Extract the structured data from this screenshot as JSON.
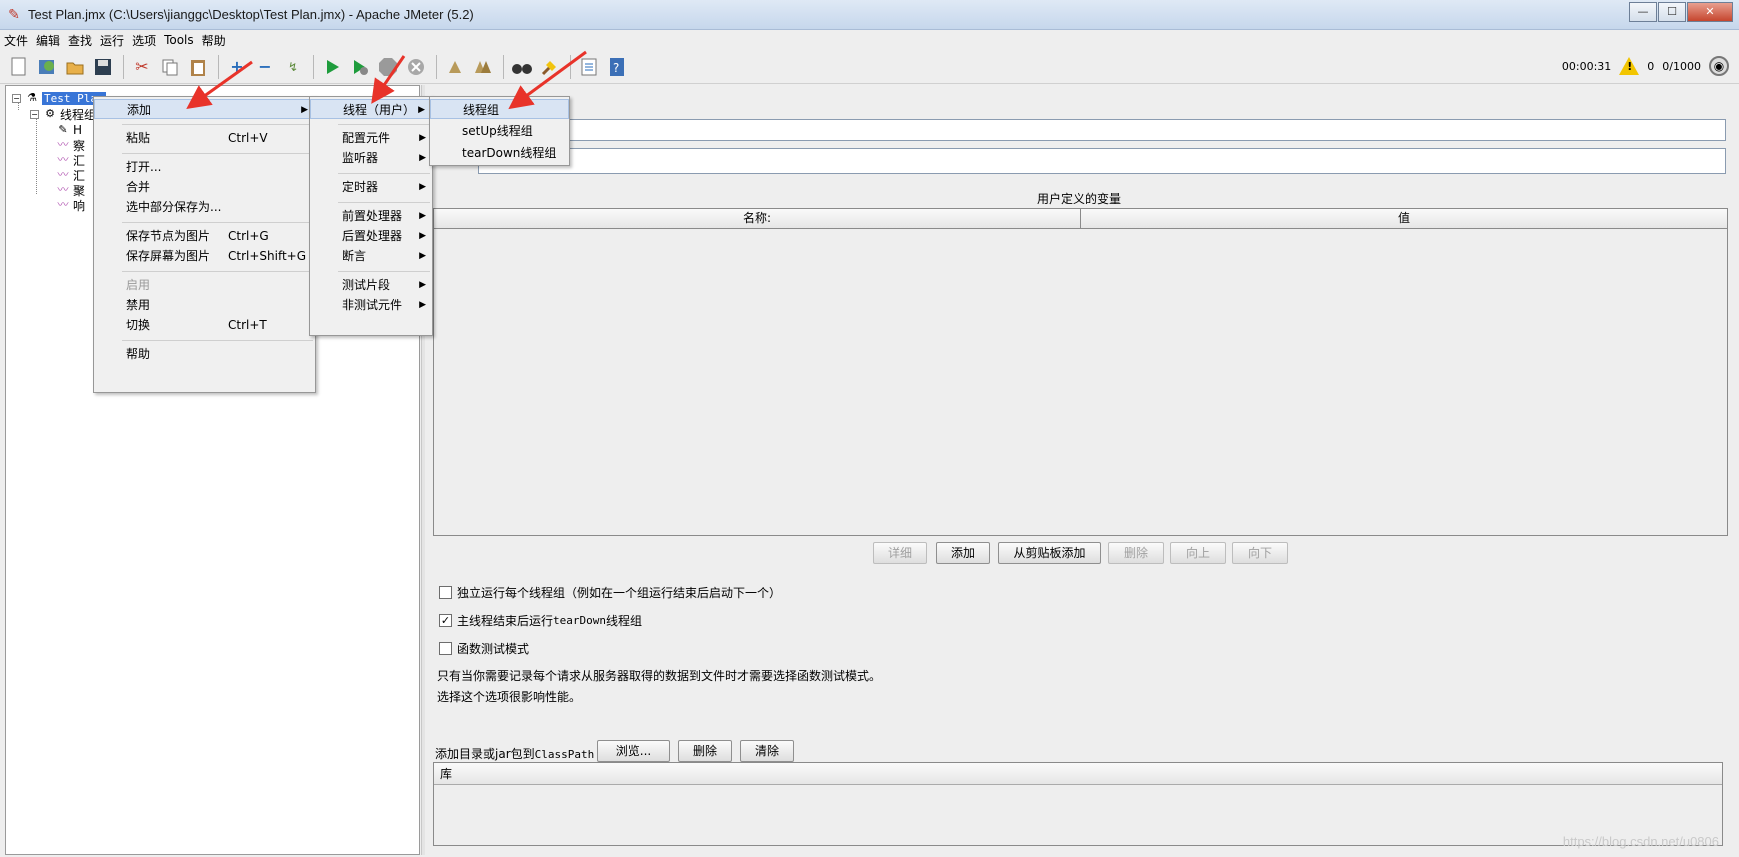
{
  "window": {
    "title": "Test Plan.jmx (C:\\Users\\jianggc\\Desktop\\Test Plan.jmx) - Apache JMeter (5.2)"
  },
  "menubar": [
    "文件",
    "编辑",
    "查找",
    "运行",
    "选项",
    "Tools",
    "帮助"
  ],
  "toolbar": {
    "icons": [
      "new-icon",
      "templates-icon",
      "open-icon",
      "save-icon",
      "cut-icon",
      "copy-icon",
      "paste-icon",
      "expand-icon",
      "collapse-icon",
      "toggle-icon",
      "start-icon",
      "start-no-pause-icon",
      "stop-icon",
      "shutdown-icon",
      "clear-icon",
      "clear-all-icon",
      "search-icon",
      "reset-search-icon",
      "function-helper-icon",
      "help-icon"
    ],
    "timer": "00:00:31",
    "warnings": "0",
    "threads": "0/1000"
  },
  "tree": {
    "root": "Test Plan",
    "thread_group": "线程组",
    "children": [
      "H",
      "察",
      "汇",
      "汇",
      "聚",
      "响"
    ]
  },
  "context_menu": {
    "items": [
      {
        "label": "添加",
        "accel": "",
        "submenu": true
      },
      {
        "label": "粘贴",
        "accel": "Ctrl+V"
      },
      {
        "label": "打开...",
        "accel": ""
      },
      {
        "label": "合并",
        "accel": ""
      },
      {
        "label": "选中部分保存为...",
        "accel": ""
      },
      {
        "label": "保存节点为图片",
        "accel": "Ctrl+G"
      },
      {
        "label": "保存屏幕为图片",
        "accel": "Ctrl+Shift+G"
      },
      {
        "label": "启用",
        "accel": "",
        "disabled": true
      },
      {
        "label": "禁用",
        "accel": ""
      },
      {
        "label": "切换",
        "accel": "Ctrl+T"
      },
      {
        "label": "帮助",
        "accel": ""
      }
    ]
  },
  "add_submenu": {
    "items": [
      "线程（用户）",
      "配置元件",
      "监听器",
      "定时器",
      "前置处理器",
      "后置处理器",
      "断言",
      "测试片段",
      "非测试元件"
    ]
  },
  "thread_submenu": {
    "items": [
      "线程组",
      "setUp线程组",
      "tearDown线程组"
    ]
  },
  "main": {
    "vars_title": "用户定义的变量",
    "col_name": "名称:",
    "col_value": "值",
    "buttons": {
      "detail": "详细",
      "add": "添加",
      "add_clipboard": "从剪贴板添加",
      "delete": "删除",
      "up": "向上",
      "down": "向下"
    },
    "chk_independent": "独立运行每个线程组（例如在一个组运行结束后启动下一个）",
    "chk_teardown_prefix": "主线程结束后运行 ",
    "chk_teardown_mono": "tearDown",
    "chk_teardown_suffix": "线程组",
    "chk_functional": "函数测试模式",
    "info_line1": "只有当你需要记录每个请求从服务器取得的数据到文件时才需要选择函数测试模式。",
    "info_line2": "选择这个选项很影响性能。",
    "classpath_label_prefix": "添加目录或jar包到",
    "classpath_label_mono": "ClassPath",
    "browse": "浏览...",
    "delete2": "删除",
    "clear": "清除",
    "lib_header": "库"
  },
  "watermark": "https://blog.csdn.net/u0806",
  "colors": {
    "selection": "#3875d7",
    "arrow": "#e8332a"
  }
}
